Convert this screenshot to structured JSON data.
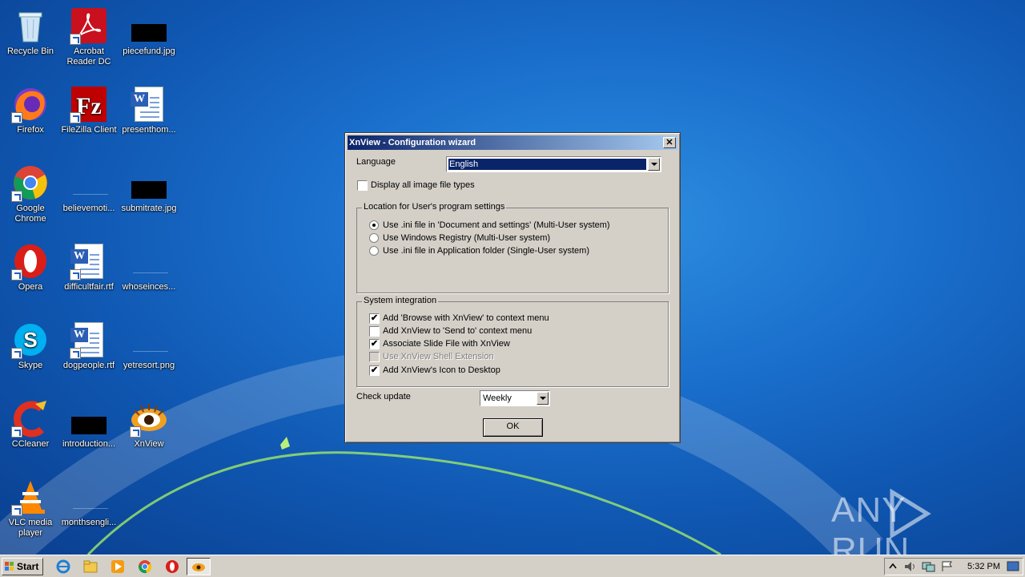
{
  "desktop": {
    "icons": [
      {
        "label": "Recycle Bin"
      },
      {
        "label": "Acrobat Reader DC"
      },
      {
        "label": "piecefund.jpg"
      },
      {
        "label": "Firefox"
      },
      {
        "label": "FileZilla Client"
      },
      {
        "label": "presenthom..."
      },
      {
        "label": "Google Chrome"
      },
      {
        "label": "believemoti..."
      },
      {
        "label": "submitrate.jpg"
      },
      {
        "label": "Opera"
      },
      {
        "label": "difficultfair.rtf"
      },
      {
        "label": "whoseinces..."
      },
      {
        "label": "Skype"
      },
      {
        "label": "dogpeople.rtf"
      },
      {
        "label": "yetresort.png"
      },
      {
        "label": "CCleaner"
      },
      {
        "label": "introduction..."
      },
      {
        "label": "XnView"
      },
      {
        "label": "VLC media player"
      },
      {
        "label": "monthsengli..."
      }
    ]
  },
  "dialog": {
    "title": "XnView - Configuration wizard",
    "close_glyph": "✕",
    "language_label": "Language",
    "language_value": "English",
    "display_all_label": "Display all image file types",
    "display_all_checked": false,
    "location_group": {
      "title": "Location for User's program settings",
      "options": [
        {
          "label": "Use .ini file in 'Document and settings' (Multi-User system)",
          "selected": true
        },
        {
          "label": "Use Windows Registry (Multi-User system)",
          "selected": false
        },
        {
          "label": "Use .ini file in Application folder (Single-User system)",
          "selected": false
        }
      ]
    },
    "integration_group": {
      "title": "System integration",
      "options": [
        {
          "label": "Add 'Browse with XnView' to context menu",
          "checked": true,
          "enabled": true
        },
        {
          "label": "Add XnView to 'Send to' context menu",
          "checked": false,
          "enabled": true
        },
        {
          "label": "Associate Slide File with XnView",
          "checked": true,
          "enabled": true
        },
        {
          "label": "Use XnView Shell Extension",
          "checked": false,
          "enabled": false
        },
        {
          "label": "Add XnView's Icon to Desktop",
          "checked": true,
          "enabled": true
        }
      ]
    },
    "check_update_label": "Check update",
    "check_update_value": "Weekly",
    "ok_label": "OK",
    "check_glyph": "✔"
  },
  "watermark": {
    "text_left": "ANY",
    "text_right": "RUN"
  },
  "taskbar": {
    "start_label": "Start",
    "clock": "5:32 PM"
  },
  "colors": {
    "title_bar_start": "#0a246a",
    "title_bar_end": "#a6caf0",
    "dialog_face": "#d4d0c8",
    "selection": "#0a246a"
  }
}
